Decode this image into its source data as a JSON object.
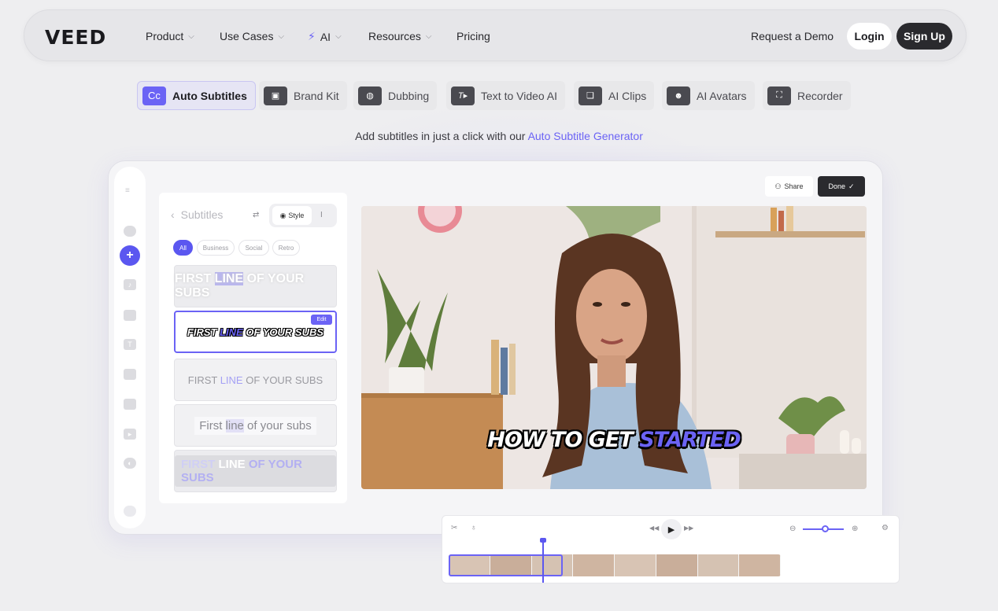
{
  "nav": {
    "logo": "VEED",
    "links": [
      "Product",
      "Use Cases",
      "AI",
      "Resources",
      "Pricing"
    ],
    "request_demo": "Request a Demo",
    "login": "Login",
    "signup": "Sign Up"
  },
  "features": [
    {
      "icon": "Cc",
      "label": "Auto Subtitles"
    },
    {
      "icon": "",
      "label": "Brand Kit"
    },
    {
      "icon": "",
      "label": "Dubbing"
    },
    {
      "icon": "T",
      "label": "Text to Video AI"
    },
    {
      "icon": "",
      "label": "AI Clips"
    },
    {
      "icon": "",
      "label": "AI Avatars"
    },
    {
      "icon": "",
      "label": "Recorder"
    }
  ],
  "tagline": {
    "text": "Add subtitles in just a click with our ",
    "link": "Auto Subtitle Generator"
  },
  "editor": {
    "share": "Share",
    "done": "Done",
    "panel_title": "Subtitles",
    "style_label": "Style",
    "chips": [
      "All",
      "Business",
      "Social",
      "Retro"
    ],
    "edit_badge": "Edit",
    "cards": [
      {
        "pre": "FIRST ",
        "hl": "LINE",
        "post": " OF YOUR SUBS"
      },
      {
        "pre": "FIRST ",
        "hl": "LINE",
        "post": " OF YOUR SUBS"
      },
      {
        "pre": "FIRST ",
        "hl": "LINE",
        "post": " OF YOUR SUBS"
      },
      {
        "pre": "First ",
        "hl": "line",
        "post": " of your subs"
      },
      {
        "pre": "FIRST ",
        "hl": "LINE",
        "post": " OF YOUR SUBS"
      }
    ],
    "caption": {
      "pre": "HOW TO GET ",
      "hl": "STARTED"
    }
  },
  "colors": {
    "accent": "#6b63f5",
    "dark": "#2a2a2e"
  }
}
